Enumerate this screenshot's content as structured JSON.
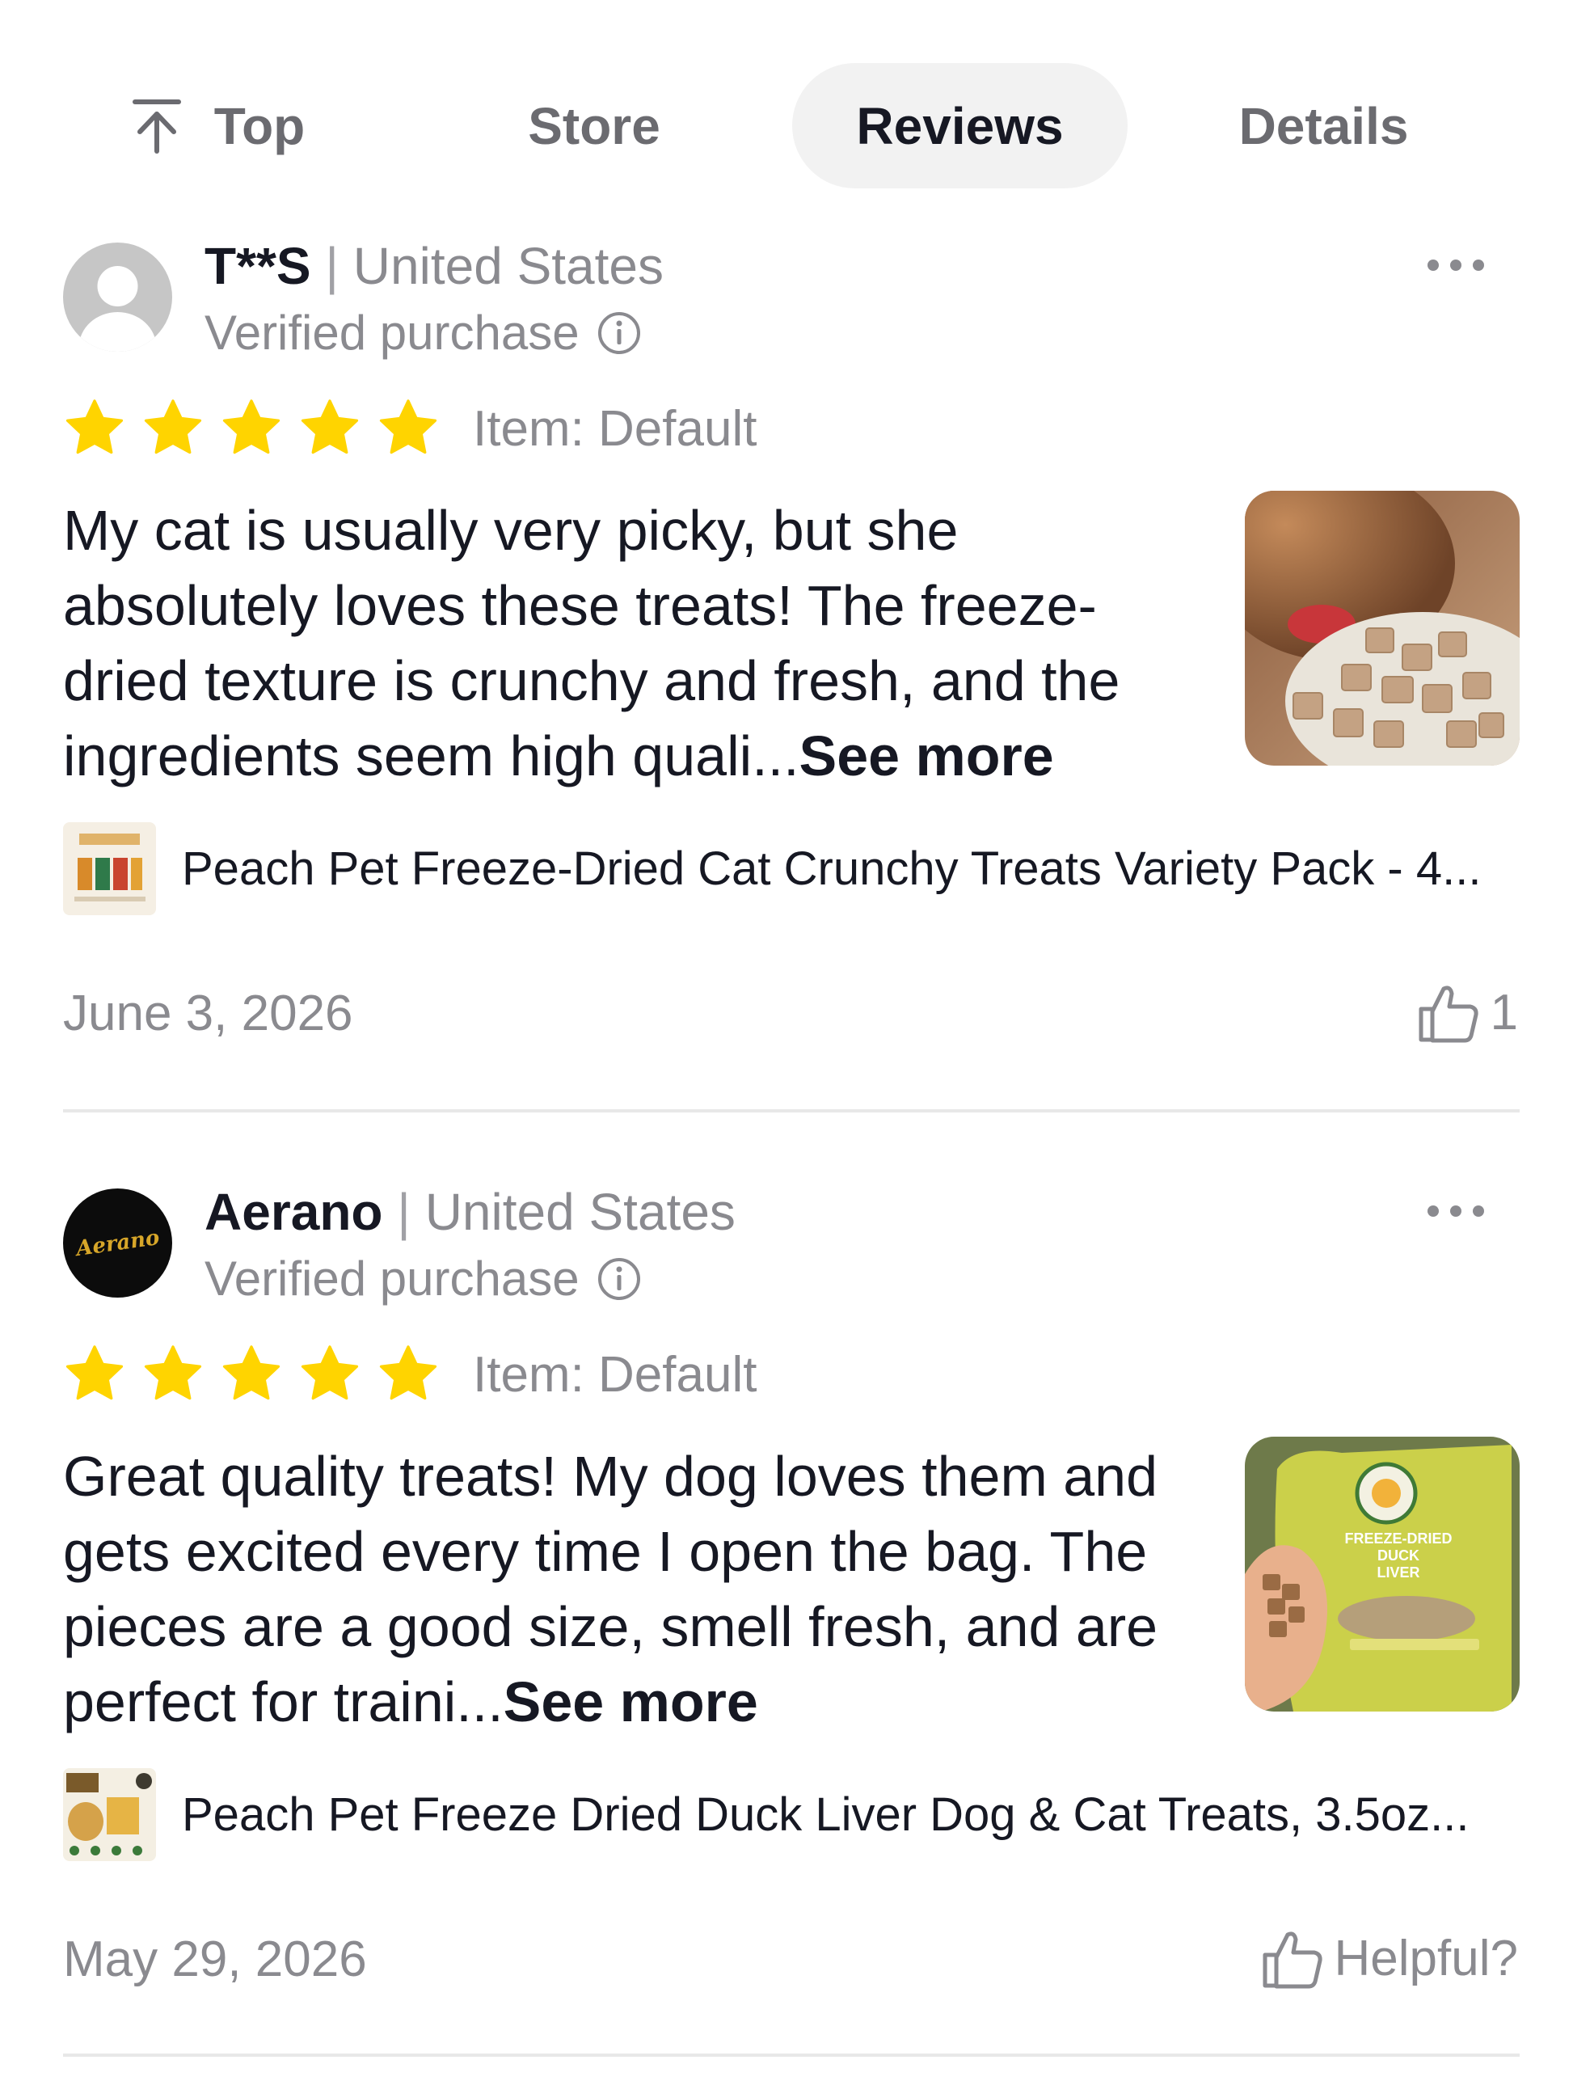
{
  "tabs": [
    {
      "label": "Top",
      "icon": "arrow-up-to-top-icon"
    },
    {
      "label": "Store"
    },
    {
      "label": "Reviews",
      "active": true
    },
    {
      "label": "Details"
    }
  ],
  "reviews": [
    {
      "user": "T**S",
      "separator": "|",
      "country": "United States",
      "verified": "Verified purchase",
      "rating": 5,
      "item": "Item: Default",
      "text": "My cat is usually very picky, but she absolutely loves these treats! The freeze-dried texture is crunchy and fresh, and the ingredients seem high quali...",
      "see_more": "See more",
      "product": "Peach Pet Freeze-Dried Cat Crunchy Treats Variety Pack - 4...",
      "date": "June 3, 2026",
      "helpful": "1"
    },
    {
      "user": "Aerano",
      "avatar_text": "Aerano",
      "separator": "|",
      "country": "United States",
      "verified": "Verified purchase",
      "rating": 5,
      "item": "Item: Default",
      "text": "Great quality treats! My dog loves them and gets excited every time I open the bag. The pieces are a good size, smell fresh, and are perfect for traini...",
      "see_more": "See more",
      "product": "Peach Pet Freeze Dried Duck Liver Dog & Cat Treats, 3.5oz...",
      "date": "May 29, 2026",
      "helpful": "Helpful?",
      "photo_label": [
        "FREEZE-DRIED",
        "DUCK",
        "LIVER"
      ]
    }
  ],
  "colors": {
    "star": "#FFD400",
    "muted": "#8A8A8F",
    "text": "#161823",
    "tab_active_bg": "#F2F2F2"
  }
}
